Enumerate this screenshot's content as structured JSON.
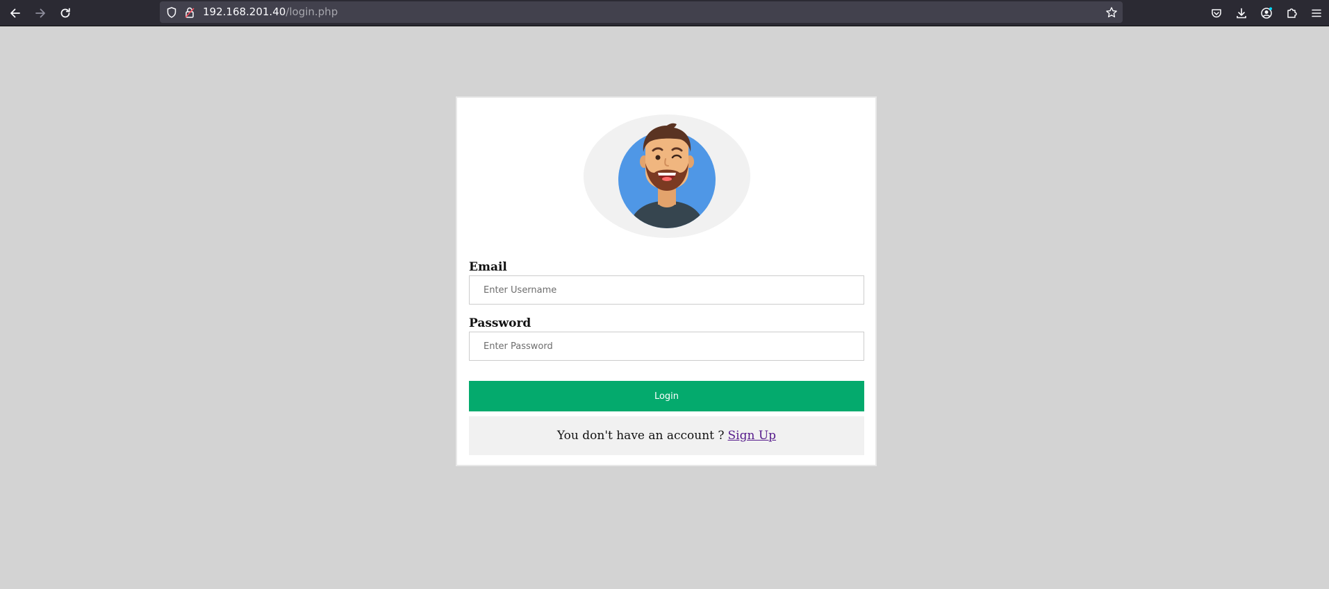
{
  "browser": {
    "url_host": "192.168.201.40",
    "url_path": "/login.php"
  },
  "icons": {
    "back": "back-arrow-icon",
    "forward": "forward-arrow-icon",
    "reload": "reload-icon",
    "tracking": "shield-icon",
    "lock": "insecure-lock-icon",
    "bookmark": "star-icon",
    "pocket": "pocket-icon",
    "downloads": "download-icon",
    "account": "account-icon",
    "extensions": "extensions-icon",
    "menu": "hamburger-menu-icon"
  },
  "colors": {
    "page_background": "#d3d3d3",
    "login_button": "#04aa6d",
    "avatar_circle": "#4f97e6",
    "signup_link": "#551a8b"
  },
  "form": {
    "email_label": "Email",
    "email_placeholder": "Enter Username",
    "email_value": "",
    "password_label": "Password",
    "password_placeholder": "Enter Password",
    "password_value": "",
    "login_label": "Login",
    "signup_prompt": "You don't have an account ?",
    "signup_link": "Sign Up"
  }
}
